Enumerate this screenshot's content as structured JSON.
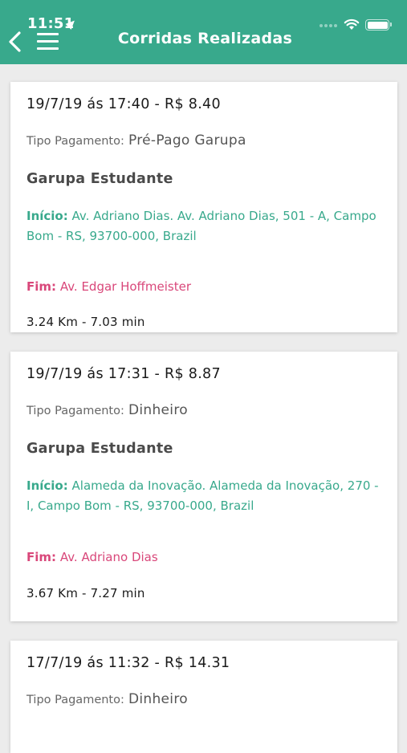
{
  "status_bar": {
    "time": "11:51"
  },
  "nav": {
    "title": "Corridas Realizadas"
  },
  "labels": {
    "payment_type": "Tipo Pagamento:",
    "start": "Início:",
    "end": "Fim:"
  },
  "rides": [
    {
      "heading": "19/7/19 ás 17:40 - R$ 8.40",
      "payment": "Pré-Pago Garupa",
      "service": "Garupa Estudante",
      "start": "Av. Adriano Dias. Av. Adriano Dias, 501 - A, Campo Bom - RS, 93700-000, Brazil",
      "end": "Av. Edgar Hoffmeister",
      "distance_time": "3.24 Km - 7.03 min"
    },
    {
      "heading": "19/7/19 ás 17:31 - R$ 8.87",
      "payment": "Dinheiro",
      "service": "Garupa Estudante",
      "start": "Alameda da Inovação. Alameda da Inovação, 270 - I, Campo Bom - RS, 93700-000, Brazil",
      "end": "Av. Adriano Dias",
      "distance_time": "3.67 Km - 7.27 min"
    },
    {
      "heading": "17/7/19 ás 11:32 - R$ 14.31",
      "payment": "Dinheiro"
    }
  ],
  "colors": {
    "header": "#38a98c",
    "start_text": "#38a98c",
    "end_text": "#d9477a",
    "background": "#ececec"
  }
}
